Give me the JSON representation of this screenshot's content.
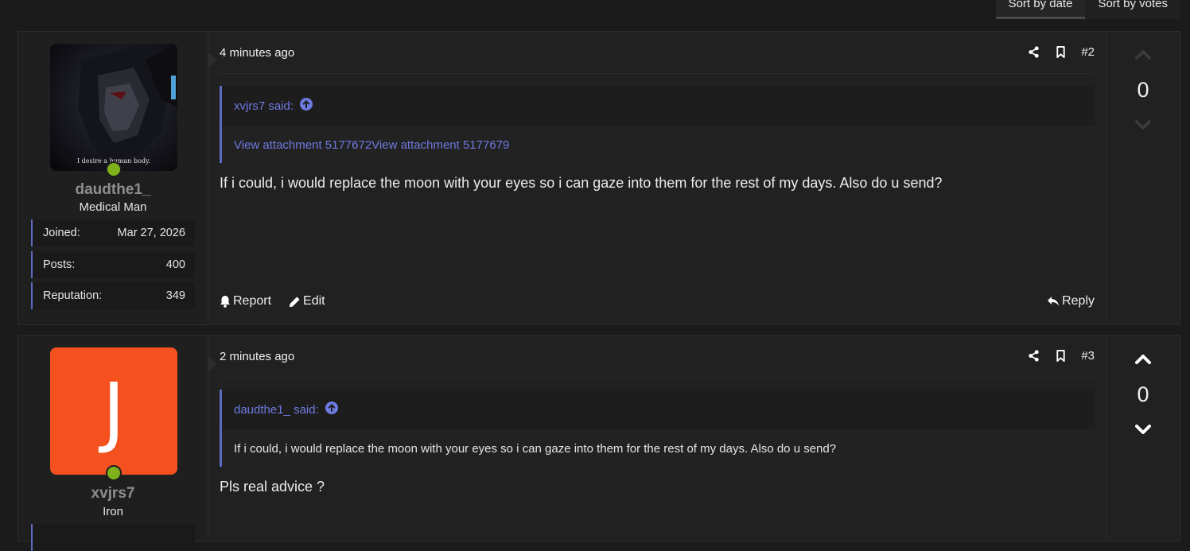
{
  "sort": {
    "by_date": "Sort by date",
    "by_votes": "Sort by votes"
  },
  "colors": {
    "accent": "#5c6bc0",
    "link": "#6f7ae0",
    "online": "#7fb21a",
    "avatar_orange": "#f4511e"
  },
  "posts": [
    {
      "timestamp": "4 minutes ago",
      "number": "#2",
      "user": {
        "name": "daudthe1_",
        "title": "Medical Man",
        "avatar_caption": "I desire a human body.",
        "stats": [
          {
            "label": "Joined:",
            "value": "Mar 27, 2026"
          },
          {
            "label": "Posts:",
            "value": "400"
          },
          {
            "label": "Reputation:",
            "value": "349"
          }
        ]
      },
      "quote": {
        "author": "xvjrs7 said:",
        "body": "View attachment 5177672View attachment 5177679"
      },
      "message": "If i could, i would replace the moon with your eyes so i can gaze into them for the rest of my days. Also do u send?",
      "actions": {
        "report": "Report",
        "edit": "Edit",
        "reply": "Reply"
      },
      "votes": "0"
    },
    {
      "timestamp": "2 minutes ago",
      "number": "#3",
      "user": {
        "name": "xvjrs7",
        "title": "Iron",
        "avatar_letter": "J"
      },
      "quote": {
        "author": "daudthe1_ said:",
        "body": "If i could, i would replace the moon with your eyes so i can gaze into them for the rest of my days. Also do u send?"
      },
      "message": "Pls real advice ?",
      "votes": "0"
    }
  ]
}
